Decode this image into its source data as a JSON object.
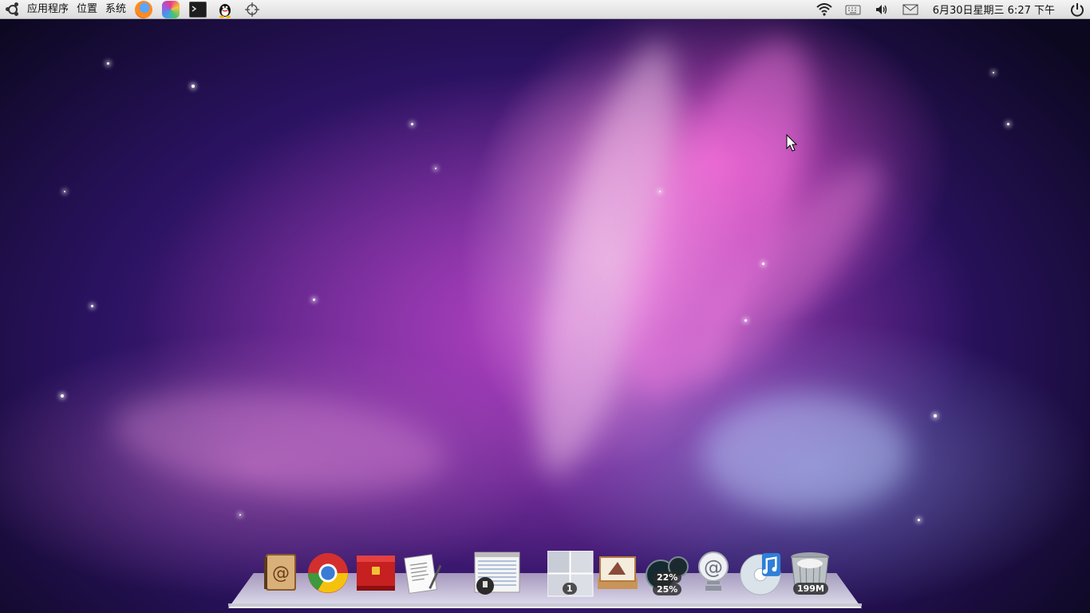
{
  "top_panel": {
    "menus": {
      "applications": "应用程序",
      "places": "位置",
      "system": "系统"
    },
    "launchers": [
      "firefox-icon",
      "color-picker-icon",
      "terminal-icon",
      "qq-icon",
      "crosshair-icon"
    ],
    "tray": [
      "wifi-icon",
      "keyboard-icon",
      "volume-icon",
      "mail-icon"
    ],
    "clock": "6月30日星期三  6:27 下午",
    "power": "power-icon"
  },
  "dock": {
    "items": [
      {
        "name": "address-book-icon"
      },
      {
        "name": "chrome-icon"
      },
      {
        "name": "red-case-icon"
      },
      {
        "name": "text-editor-icon"
      },
      {
        "name": "screenshot-thumbnail-icon"
      },
      {
        "name": "workspace-switcher-icon",
        "badge": "1"
      },
      {
        "name": "image-viewer-icon"
      },
      {
        "name": "cpu-monitor-icon",
        "badge_top": "22%",
        "badge_bottom": "25%"
      },
      {
        "name": "mail-at-icon"
      },
      {
        "name": "itunes-icon"
      },
      {
        "name": "trash-icon",
        "badge": "199M"
      }
    ]
  },
  "colors": {
    "panel_bg": "#e6e6e6",
    "wallpaper_pink": "#d94fc4",
    "wallpaper_purple": "#4a1f7a"
  }
}
